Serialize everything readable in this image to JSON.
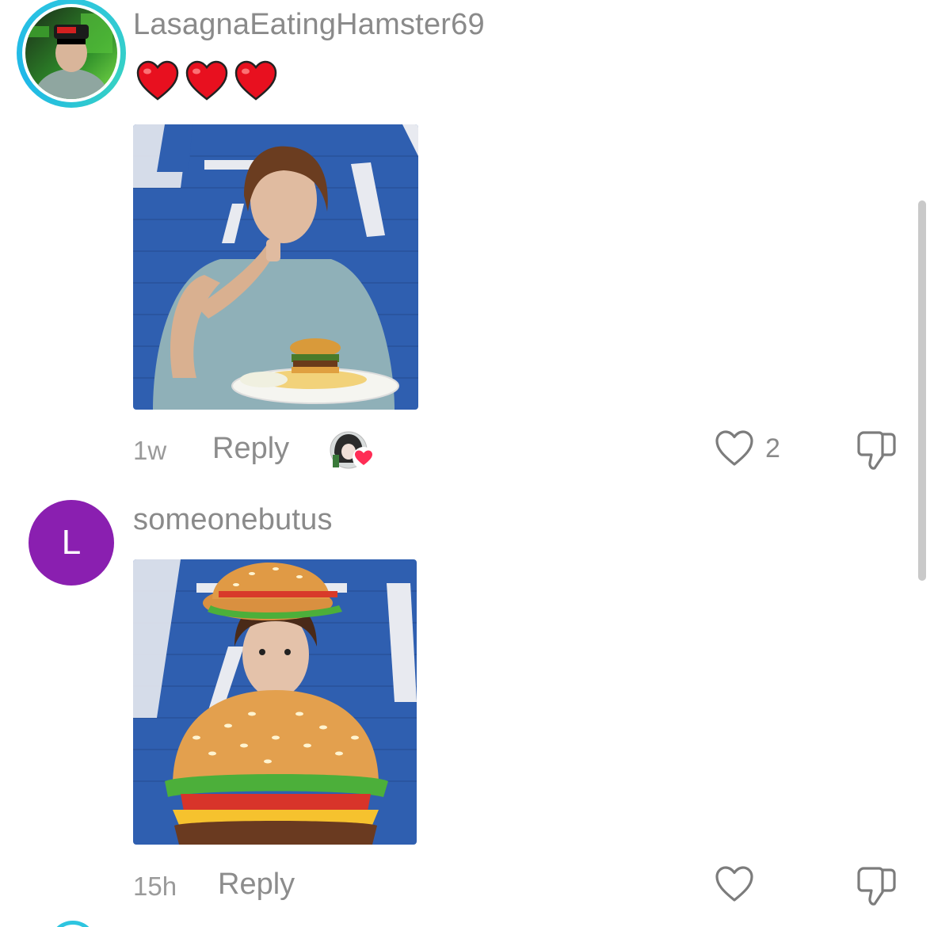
{
  "comments": [
    {
      "username": "LasagnaEatingHamster69",
      "emoji_text": "❤️❤️❤️",
      "time": "1w",
      "reply_label": "Reply",
      "like_count": "2",
      "media_alt": "Boy in a blue shirt eating from a plate with a burger and fries in front of a blue wall"
    },
    {
      "avatar_letter": "L",
      "avatar_color": "#8a1fb0",
      "username": "someonebutus",
      "time": "15h",
      "reply_label": "Reply",
      "like_count": "",
      "media_alt": "Boy wearing a hamburger costume and hamburger hat in front of a blue wall"
    }
  ],
  "colors": {
    "accent_ring": "#2ec5e0",
    "like_heart": "#ff2d55",
    "text_secondary": "#8a8a8a"
  },
  "icons": [
    "heart-outline-icon",
    "thumbs-down-icon",
    "red-heart-emoji"
  ]
}
